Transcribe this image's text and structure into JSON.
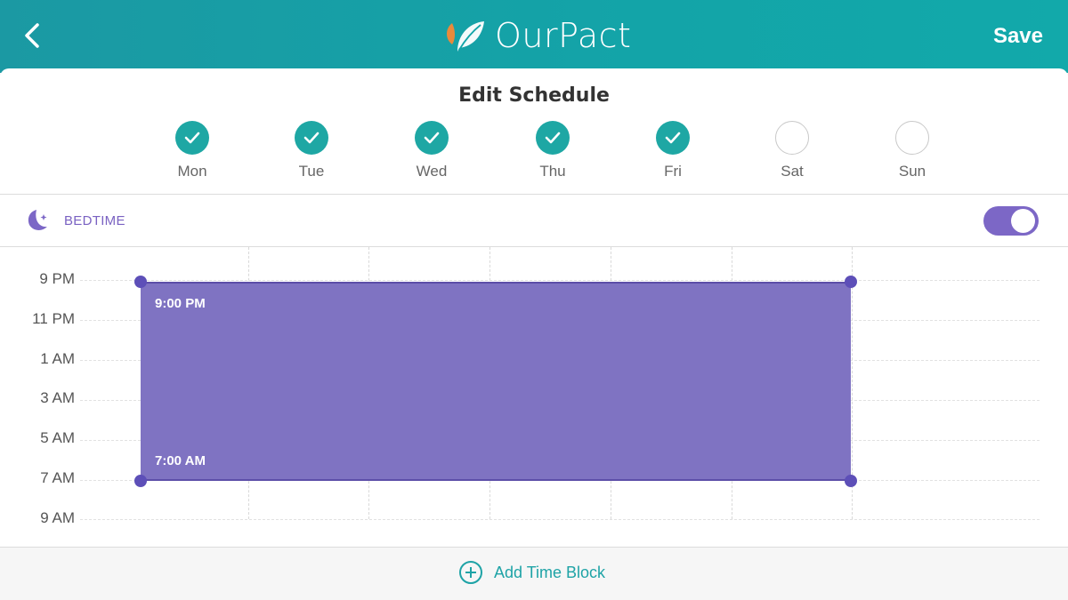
{
  "header": {
    "brand_name": "OurPact",
    "save_label": "Save",
    "color": "#13a4a8"
  },
  "schedule": {
    "title": "Edit Schedule",
    "days": [
      {
        "label": "Mon",
        "selected": true
      },
      {
        "label": "Tue",
        "selected": true
      },
      {
        "label": "Wed",
        "selected": true
      },
      {
        "label": "Thu",
        "selected": true
      },
      {
        "label": "Fri",
        "selected": true
      },
      {
        "label": "Sat",
        "selected": false
      },
      {
        "label": "Sun",
        "selected": false
      }
    ]
  },
  "bedtime": {
    "label": "BEDTIME",
    "enabled": true,
    "icon": "moon-icon",
    "accent": "#7c67c6"
  },
  "timeline": {
    "time_labels": [
      "9 PM",
      "11 PM",
      "1 AM",
      "3 AM",
      "5 AM",
      "7 AM",
      "9 AM"
    ],
    "block": {
      "start_label": "9:00 PM",
      "end_label": "7:00 AM",
      "color": "#7f73c2"
    }
  },
  "footer": {
    "add_label": "Add Time Block",
    "icon": "plus-circle-icon"
  }
}
